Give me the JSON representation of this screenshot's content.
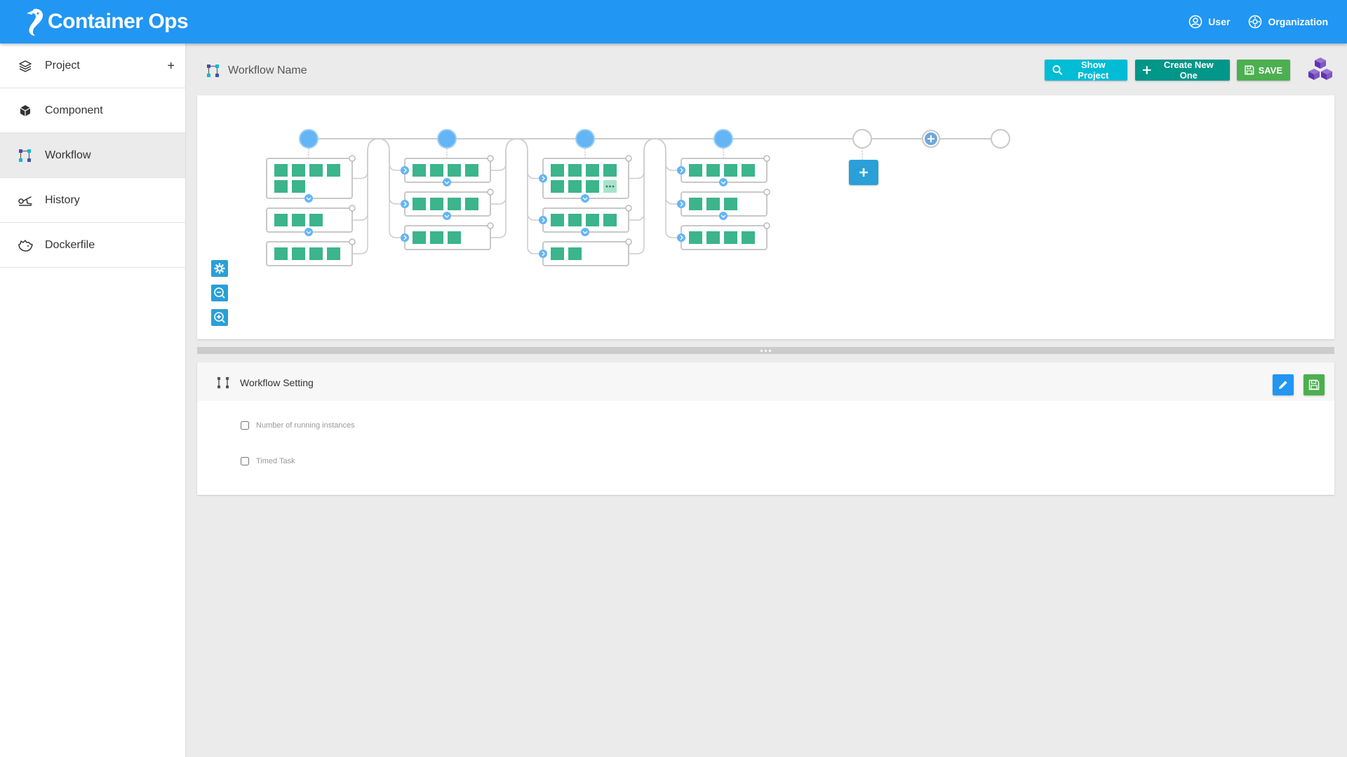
{
  "app": {
    "title": "Container Ops"
  },
  "topbar": {
    "user_label": "User",
    "org_label": "Organization"
  },
  "sidebar": {
    "items": [
      {
        "label": "Project",
        "icon": "layers-icon",
        "has_add": true,
        "add_label": "+"
      },
      {
        "label": "Component",
        "icon": "cube-icon"
      },
      {
        "label": "Workflow",
        "icon": "workflow-icon",
        "active": true
      },
      {
        "label": "History",
        "icon": "history-icon"
      },
      {
        "label": "Dockerfile",
        "icon": "docker-icon"
      }
    ]
  },
  "header": {
    "title": "Workflow Name",
    "show_project_label": "Show Project",
    "create_label": "Create New One",
    "save_label": "SAVE"
  },
  "workflow": {
    "stages": [
      {
        "kind": "filled",
        "actions": [
          {
            "components": 6
          },
          {
            "components": 3
          },
          {
            "components": 4
          }
        ]
      },
      {
        "kind": "filled",
        "actions": [
          {
            "components": 4
          },
          {
            "components": 4
          },
          {
            "components": 3
          }
        ]
      },
      {
        "kind": "filled",
        "actions": [
          {
            "components": 7,
            "more": true
          },
          {
            "components": 4
          },
          {
            "components": 2
          }
        ]
      },
      {
        "kind": "filled",
        "actions": [
          {
            "components": 4
          },
          {
            "components": 3
          },
          {
            "components": 4
          }
        ]
      },
      {
        "kind": "empty"
      },
      {
        "kind": "add"
      },
      {
        "kind": "empty"
      }
    ],
    "colors": {
      "stage_fill": "#64b5f6",
      "component": "#3cb48c",
      "line": "#cccccc",
      "accent": "#2a9fd8"
    }
  },
  "toolbar": {
    "settings_icon": "gear-icon",
    "zoom_out_icon": "zoom-out-icon",
    "zoom_in_icon": "zoom-in-icon"
  },
  "settings": {
    "title": "Workflow Setting",
    "options": [
      {
        "label": "Number of running instances",
        "checked": false
      },
      {
        "label": "Timed Task",
        "checked": false
      }
    ]
  },
  "colors": {
    "primary": "#2196f3",
    "cyan": "#00bcd4",
    "teal": "#009688",
    "green": "#4caf50"
  }
}
